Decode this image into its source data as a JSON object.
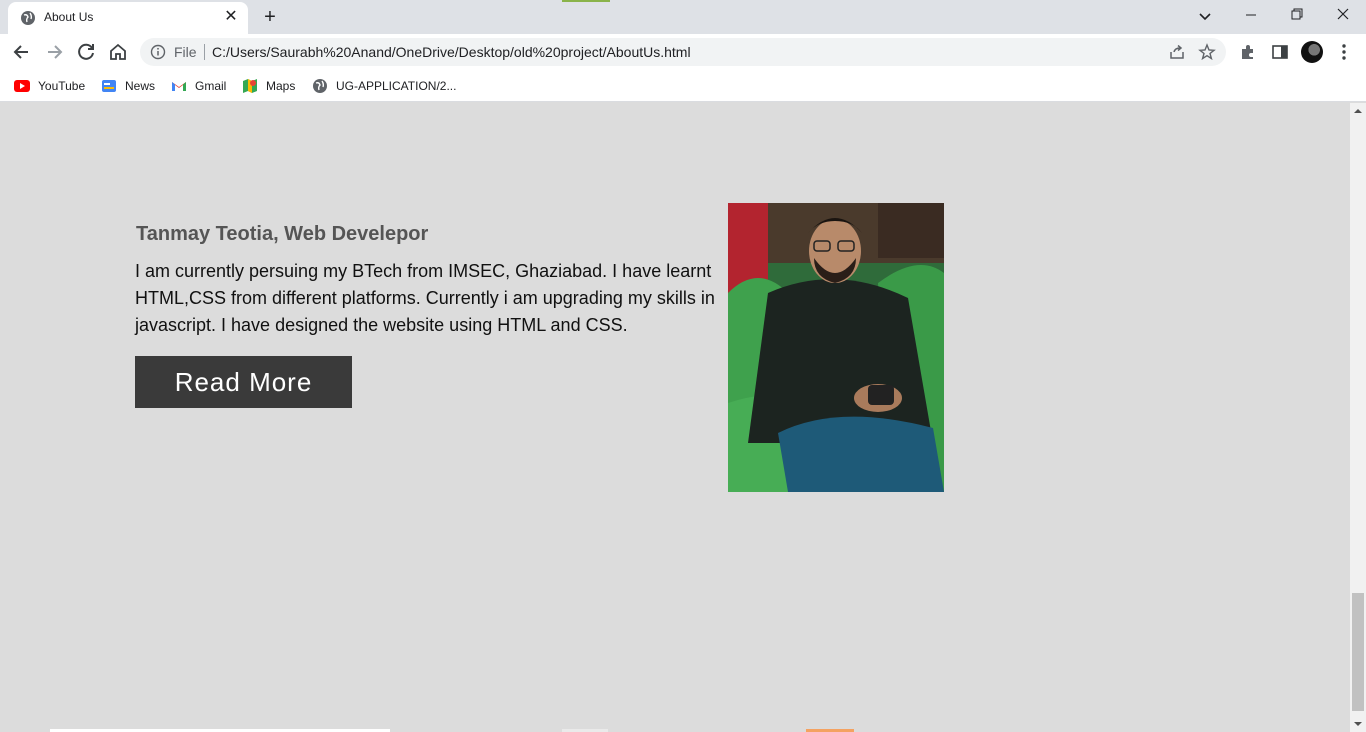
{
  "browser": {
    "tab_title": "About Us",
    "omnibox_scheme": "File",
    "url": "C:/Users/Saurabh%20Anand/OneDrive/Desktop/old%20project/AboutUs.html"
  },
  "bookmarks": [
    {
      "label": "YouTube",
      "icon": "youtube-icon"
    },
    {
      "label": "News",
      "icon": "news-icon"
    },
    {
      "label": "Gmail",
      "icon": "gmail-icon"
    },
    {
      "label": "Maps",
      "icon": "maps-icon"
    },
    {
      "label": "UG-APPLICATION/2...",
      "icon": "globe-icon"
    }
  ],
  "page": {
    "author_heading": "Tanmay Teotia, Web Develepor",
    "bio": "I am currently persuing my BTech from IMSEC, Ghaziabad. I have learnt HTML,CSS from different platforms. Currently i am upgrading my skills in javascript. I have designed the website using HTML and CSS.",
    "read_more_label": "Read More"
  },
  "colors": {
    "page_background": "#dcdcdc",
    "button_background": "#3a3a3a",
    "heading_text": "#555555"
  }
}
